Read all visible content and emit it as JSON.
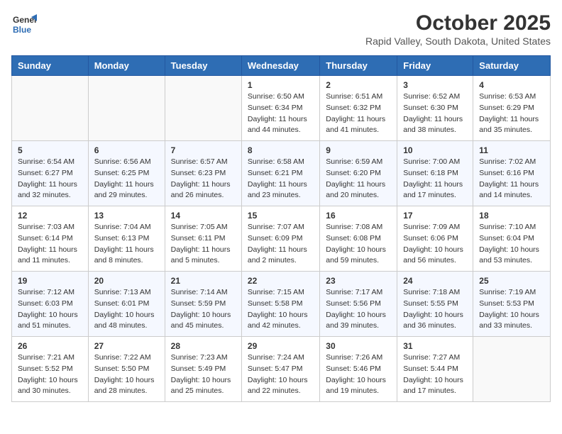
{
  "header": {
    "logo_line1": "General",
    "logo_line2": "Blue",
    "title": "October 2025",
    "subtitle": "Rapid Valley, South Dakota, United States"
  },
  "weekdays": [
    "Sunday",
    "Monday",
    "Tuesday",
    "Wednesday",
    "Thursday",
    "Friday",
    "Saturday"
  ],
  "weeks": [
    [
      {
        "day": "",
        "info": ""
      },
      {
        "day": "",
        "info": ""
      },
      {
        "day": "",
        "info": ""
      },
      {
        "day": "1",
        "info": "Sunrise: 6:50 AM\nSunset: 6:34 PM\nDaylight: 11 hours\nand 44 minutes."
      },
      {
        "day": "2",
        "info": "Sunrise: 6:51 AM\nSunset: 6:32 PM\nDaylight: 11 hours\nand 41 minutes."
      },
      {
        "day": "3",
        "info": "Sunrise: 6:52 AM\nSunset: 6:30 PM\nDaylight: 11 hours\nand 38 minutes."
      },
      {
        "day": "4",
        "info": "Sunrise: 6:53 AM\nSunset: 6:29 PM\nDaylight: 11 hours\nand 35 minutes."
      }
    ],
    [
      {
        "day": "5",
        "info": "Sunrise: 6:54 AM\nSunset: 6:27 PM\nDaylight: 11 hours\nand 32 minutes."
      },
      {
        "day": "6",
        "info": "Sunrise: 6:56 AM\nSunset: 6:25 PM\nDaylight: 11 hours\nand 29 minutes."
      },
      {
        "day": "7",
        "info": "Sunrise: 6:57 AM\nSunset: 6:23 PM\nDaylight: 11 hours\nand 26 minutes."
      },
      {
        "day": "8",
        "info": "Sunrise: 6:58 AM\nSunset: 6:21 PM\nDaylight: 11 hours\nand 23 minutes."
      },
      {
        "day": "9",
        "info": "Sunrise: 6:59 AM\nSunset: 6:20 PM\nDaylight: 11 hours\nand 20 minutes."
      },
      {
        "day": "10",
        "info": "Sunrise: 7:00 AM\nSunset: 6:18 PM\nDaylight: 11 hours\nand 17 minutes."
      },
      {
        "day": "11",
        "info": "Sunrise: 7:02 AM\nSunset: 6:16 PM\nDaylight: 11 hours\nand 14 minutes."
      }
    ],
    [
      {
        "day": "12",
        "info": "Sunrise: 7:03 AM\nSunset: 6:14 PM\nDaylight: 11 hours\nand 11 minutes."
      },
      {
        "day": "13",
        "info": "Sunrise: 7:04 AM\nSunset: 6:13 PM\nDaylight: 11 hours\nand 8 minutes."
      },
      {
        "day": "14",
        "info": "Sunrise: 7:05 AM\nSunset: 6:11 PM\nDaylight: 11 hours\nand 5 minutes."
      },
      {
        "day": "15",
        "info": "Sunrise: 7:07 AM\nSunset: 6:09 PM\nDaylight: 11 hours\nand 2 minutes."
      },
      {
        "day": "16",
        "info": "Sunrise: 7:08 AM\nSunset: 6:08 PM\nDaylight: 10 hours\nand 59 minutes."
      },
      {
        "day": "17",
        "info": "Sunrise: 7:09 AM\nSunset: 6:06 PM\nDaylight: 10 hours\nand 56 minutes."
      },
      {
        "day": "18",
        "info": "Sunrise: 7:10 AM\nSunset: 6:04 PM\nDaylight: 10 hours\nand 53 minutes."
      }
    ],
    [
      {
        "day": "19",
        "info": "Sunrise: 7:12 AM\nSunset: 6:03 PM\nDaylight: 10 hours\nand 51 minutes."
      },
      {
        "day": "20",
        "info": "Sunrise: 7:13 AM\nSunset: 6:01 PM\nDaylight: 10 hours\nand 48 minutes."
      },
      {
        "day": "21",
        "info": "Sunrise: 7:14 AM\nSunset: 5:59 PM\nDaylight: 10 hours\nand 45 minutes."
      },
      {
        "day": "22",
        "info": "Sunrise: 7:15 AM\nSunset: 5:58 PM\nDaylight: 10 hours\nand 42 minutes."
      },
      {
        "day": "23",
        "info": "Sunrise: 7:17 AM\nSunset: 5:56 PM\nDaylight: 10 hours\nand 39 minutes."
      },
      {
        "day": "24",
        "info": "Sunrise: 7:18 AM\nSunset: 5:55 PM\nDaylight: 10 hours\nand 36 minutes."
      },
      {
        "day": "25",
        "info": "Sunrise: 7:19 AM\nSunset: 5:53 PM\nDaylight: 10 hours\nand 33 minutes."
      }
    ],
    [
      {
        "day": "26",
        "info": "Sunrise: 7:21 AM\nSunset: 5:52 PM\nDaylight: 10 hours\nand 30 minutes."
      },
      {
        "day": "27",
        "info": "Sunrise: 7:22 AM\nSunset: 5:50 PM\nDaylight: 10 hours\nand 28 minutes."
      },
      {
        "day": "28",
        "info": "Sunrise: 7:23 AM\nSunset: 5:49 PM\nDaylight: 10 hours\nand 25 minutes."
      },
      {
        "day": "29",
        "info": "Sunrise: 7:24 AM\nSunset: 5:47 PM\nDaylight: 10 hours\nand 22 minutes."
      },
      {
        "day": "30",
        "info": "Sunrise: 7:26 AM\nSunset: 5:46 PM\nDaylight: 10 hours\nand 19 minutes."
      },
      {
        "day": "31",
        "info": "Sunrise: 7:27 AM\nSunset: 5:44 PM\nDaylight: 10 hours\nand 17 minutes."
      },
      {
        "day": "",
        "info": ""
      }
    ]
  ]
}
